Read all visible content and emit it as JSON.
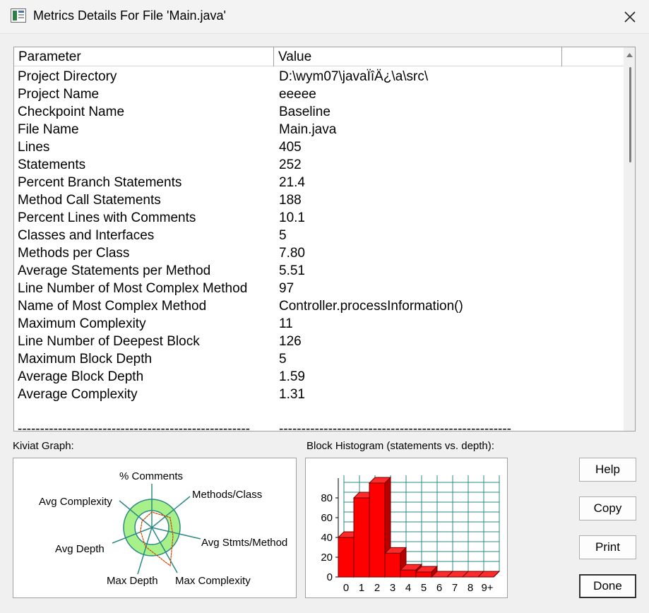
{
  "window": {
    "title": "Metrics Details For File 'Main.java'",
    "app_icon": "window-app-icon",
    "close_icon": "close-icon"
  },
  "table": {
    "columns": [
      "Parameter",
      "Value"
    ],
    "rows": [
      {
        "parameter": "Project Directory",
        "value": "D:\\wym07\\javaÏîÄ¿\\a\\src\\"
      },
      {
        "parameter": "Project Name",
        "value": "eeeee"
      },
      {
        "parameter": "Checkpoint Name",
        "value": "Baseline"
      },
      {
        "parameter": "File Name",
        "value": "Main.java"
      },
      {
        "parameter": "Lines",
        "value": "405"
      },
      {
        "parameter": "Statements",
        "value": "252"
      },
      {
        "parameter": "Percent Branch Statements",
        "value": "21.4"
      },
      {
        "parameter": "Method Call Statements",
        "value": "188"
      },
      {
        "parameter": "Percent Lines with Comments",
        "value": "10.1"
      },
      {
        "parameter": "Classes and Interfaces",
        "value": "5"
      },
      {
        "parameter": "Methods per Class",
        "value": "7.80"
      },
      {
        "parameter": "Average Statements per Method",
        "value": "5.51"
      },
      {
        "parameter": "Line Number of Most Complex Method",
        "value": "97"
      },
      {
        "parameter": "Name of Most Complex Method",
        "value": "Controller.processInformation()"
      },
      {
        "parameter": "Maximum Complexity",
        "value": "11"
      },
      {
        "parameter": "Line Number of Deepest Block",
        "value": "126"
      },
      {
        "parameter": "Maximum Block Depth",
        "value": "5"
      },
      {
        "parameter": "Average Block Depth",
        "value": "1.59"
      },
      {
        "parameter": "Average Complexity",
        "value": "1.31"
      }
    ],
    "separator_param": "----------------------------------------------------",
    "separator_value": "----------------------------------------------------"
  },
  "kiviat": {
    "label": "Kiviat Graph:",
    "axes": [
      "% Comments",
      "Methods/Class",
      "Avg Stmts/Method",
      "Max Complexity",
      "Max Depth",
      "Avg Depth",
      "Avg Complexity"
    ]
  },
  "histogram": {
    "label": "Block Histogram (statements vs. depth):",
    "y_ticks": [
      "0",
      "20",
      "40",
      "60",
      "80"
    ],
    "categories": [
      "0",
      "1",
      "2",
      "3",
      "4",
      "5",
      "6",
      "7",
      "8",
      "9+"
    ],
    "values": [
      40,
      80,
      95,
      24,
      7,
      5,
      0,
      0,
      0,
      0
    ],
    "ylim": [
      0,
      100
    ],
    "bar_color": "#ff0000"
  },
  "buttons": {
    "help": "Help",
    "copy": "Copy",
    "print": "Print",
    "done": "Done"
  }
}
